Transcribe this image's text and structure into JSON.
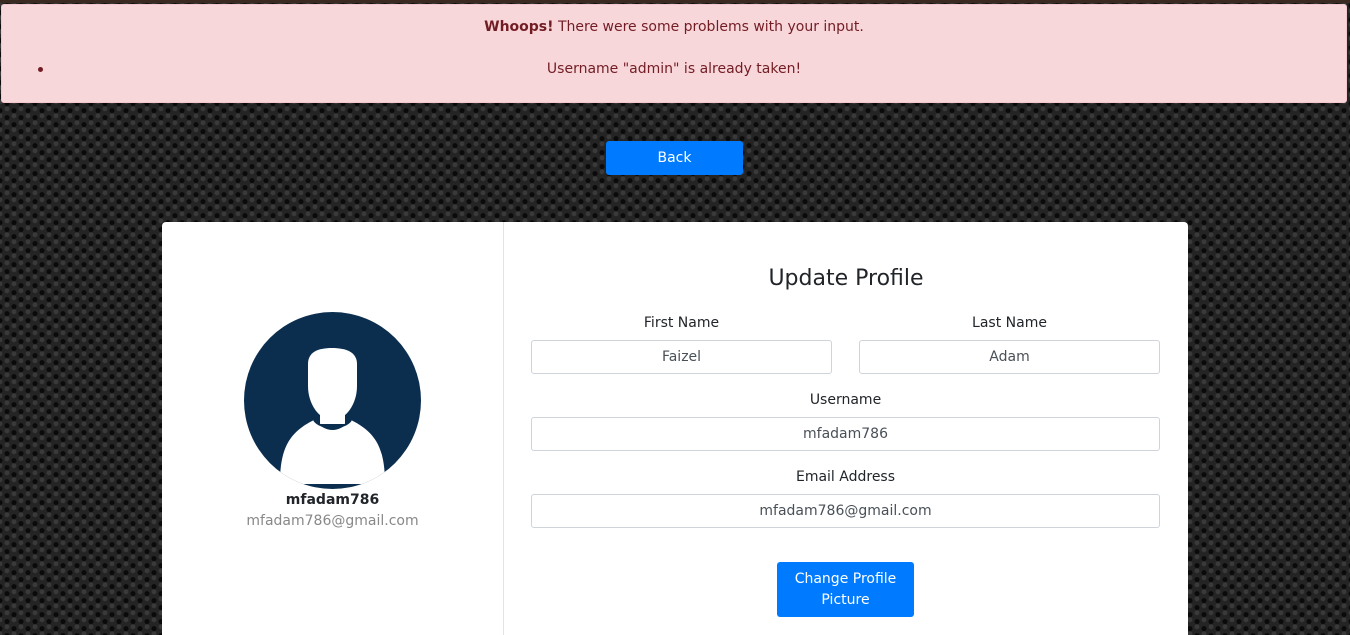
{
  "alert": {
    "title_strong": "Whoops!",
    "title_rest": " There were some problems with your input.",
    "errors": [
      "Username \"admin\" is already taken!"
    ]
  },
  "back_button": "Back",
  "profile": {
    "username": "mfadam786",
    "email": "mfadam786@gmail.com",
    "avatar_icon": "user-avatar-icon"
  },
  "form": {
    "title": "Update Profile",
    "first_name": {
      "label": "First Name",
      "value": "Faizel"
    },
    "last_name": {
      "label": "Last Name",
      "value": "Adam"
    },
    "username": {
      "label": "Username",
      "value": "mfadam786"
    },
    "email": {
      "label": "Email Address",
      "value": "mfadam786@gmail.com"
    },
    "change_picture_button": "Change Profile Picture"
  },
  "colors": {
    "primary": "#007bff",
    "alert_bg": "#f8d7da",
    "alert_text": "#721c24",
    "avatar_bg": "#0b2e4f"
  }
}
